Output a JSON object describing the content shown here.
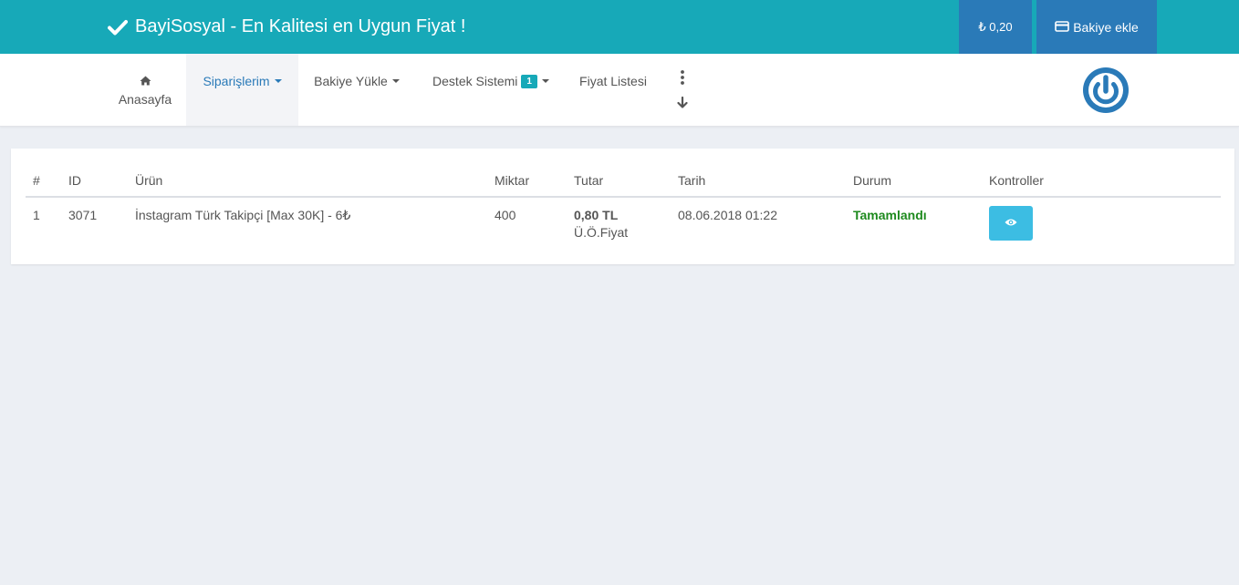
{
  "header": {
    "brand_title": "BayiSosyal - En Kalitesi en Uygun Fiyat !",
    "balance": "₺ 0,20",
    "add_balance_label": "Bakiye ekle",
    "accent_color": "#17a9b8",
    "button_color": "#2a7ab8"
  },
  "nav": {
    "home_label": "Anasayfa",
    "orders_label": "Siparişlerim",
    "load_balance_label": "Bakiye Yükle",
    "support_label": "Destek Sistemi",
    "support_badge": "1",
    "price_list_label": "Fiyat Listesi",
    "icons": [
      "home-icon",
      "more-vertical-icon",
      "arrow-down-icon",
      "power-icon"
    ]
  },
  "orders_table": {
    "columns": [
      "#",
      "ID",
      "Ürün",
      "Miktar",
      "Tutar",
      "Tarih",
      "Durum",
      "Kontroller"
    ],
    "rows": [
      {
        "index": "1",
        "id": "3071",
        "product": "İnstagram Türk Takipçi [Max 30K] - 6₺",
        "quantity": "400",
        "amount": "0,80 TL",
        "amount_note": "Ü.Ö.Fiyat",
        "date": "08.06.2018 01:22",
        "status": "Tamamlandı",
        "status_color": "#1e8a1e",
        "action_icon": "eye-icon"
      }
    ]
  }
}
